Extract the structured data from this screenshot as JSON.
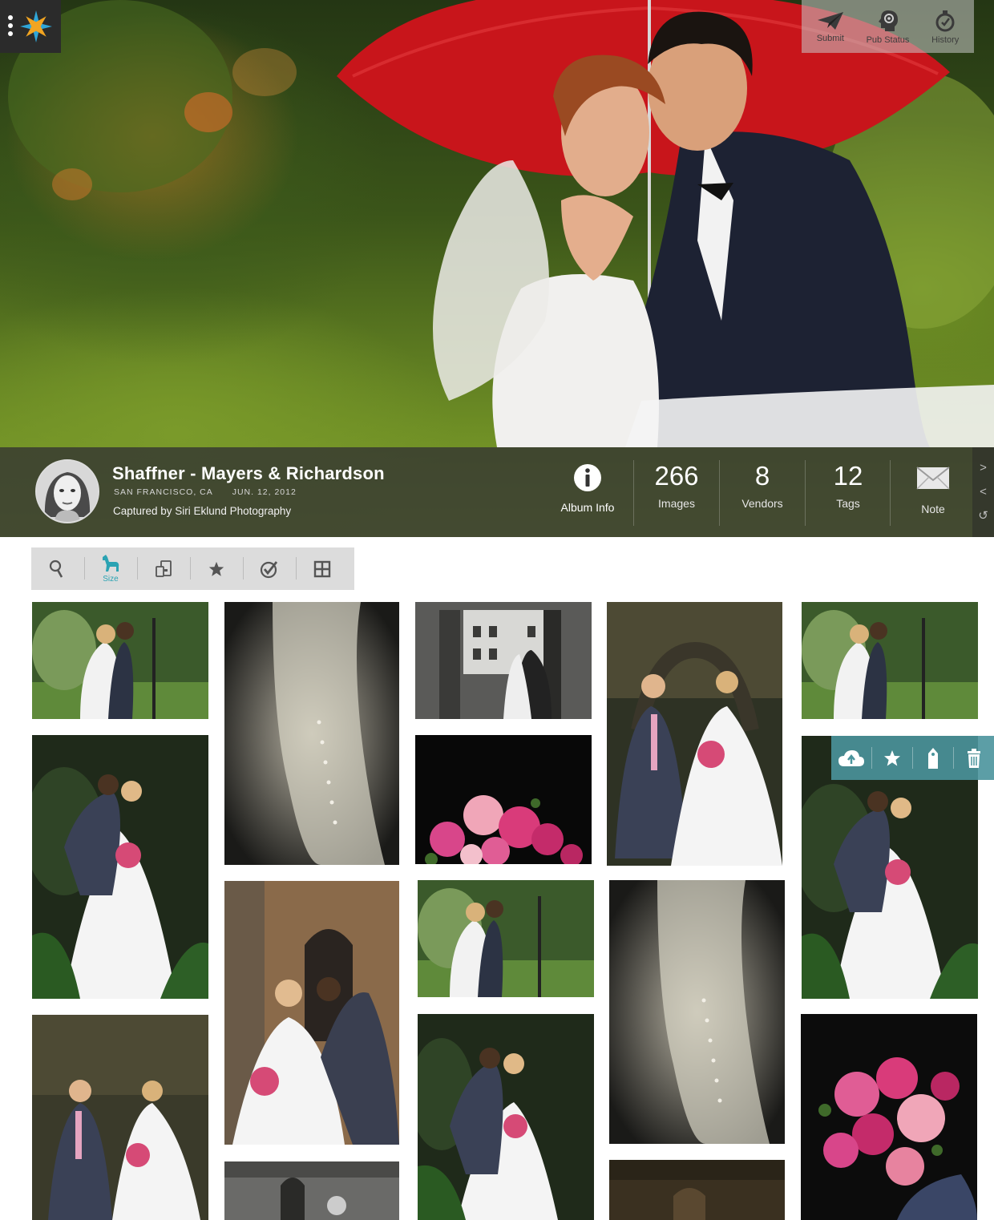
{
  "top_tools": [
    {
      "label": "Submit",
      "icon": "paper-plane-icon"
    },
    {
      "label": "Pub Status",
      "icon": "head-gears-icon"
    },
    {
      "label": "History",
      "icon": "stopwatch-icon"
    }
  ],
  "album": {
    "title": "Shaffner - Mayers & Richardson",
    "location": "SAN FRANCISCO, CA",
    "date": "JUN. 12, 2012",
    "credit": "Captured by Siri Eklund Photography"
  },
  "stats": {
    "album_info": {
      "label": "Album Info",
      "icon": "info-circle-icon"
    },
    "images": {
      "value": "266",
      "label": "Images"
    },
    "vendors": {
      "value": "8",
      "label": "Vendors"
    },
    "tags": {
      "value": "12",
      "label": "Tags"
    },
    "note": {
      "label": "Note",
      "icon": "envelope-icon"
    }
  },
  "side_nav": [
    ">",
    "<",
    "↺"
  ],
  "view_tools": {
    "active_label": "Size",
    "icons": [
      "search-icon",
      "size-icon",
      "devices-icon",
      "star-icon",
      "check-badge-icon",
      "grid-icon"
    ]
  },
  "hover_actions": [
    "cloud-upload-icon",
    "star-icon",
    "tag-icon",
    "trash-icon"
  ],
  "colors": {
    "accent": "#2ba3b3",
    "hover_bar": "#4a949c",
    "info_bar": "#323232"
  }
}
